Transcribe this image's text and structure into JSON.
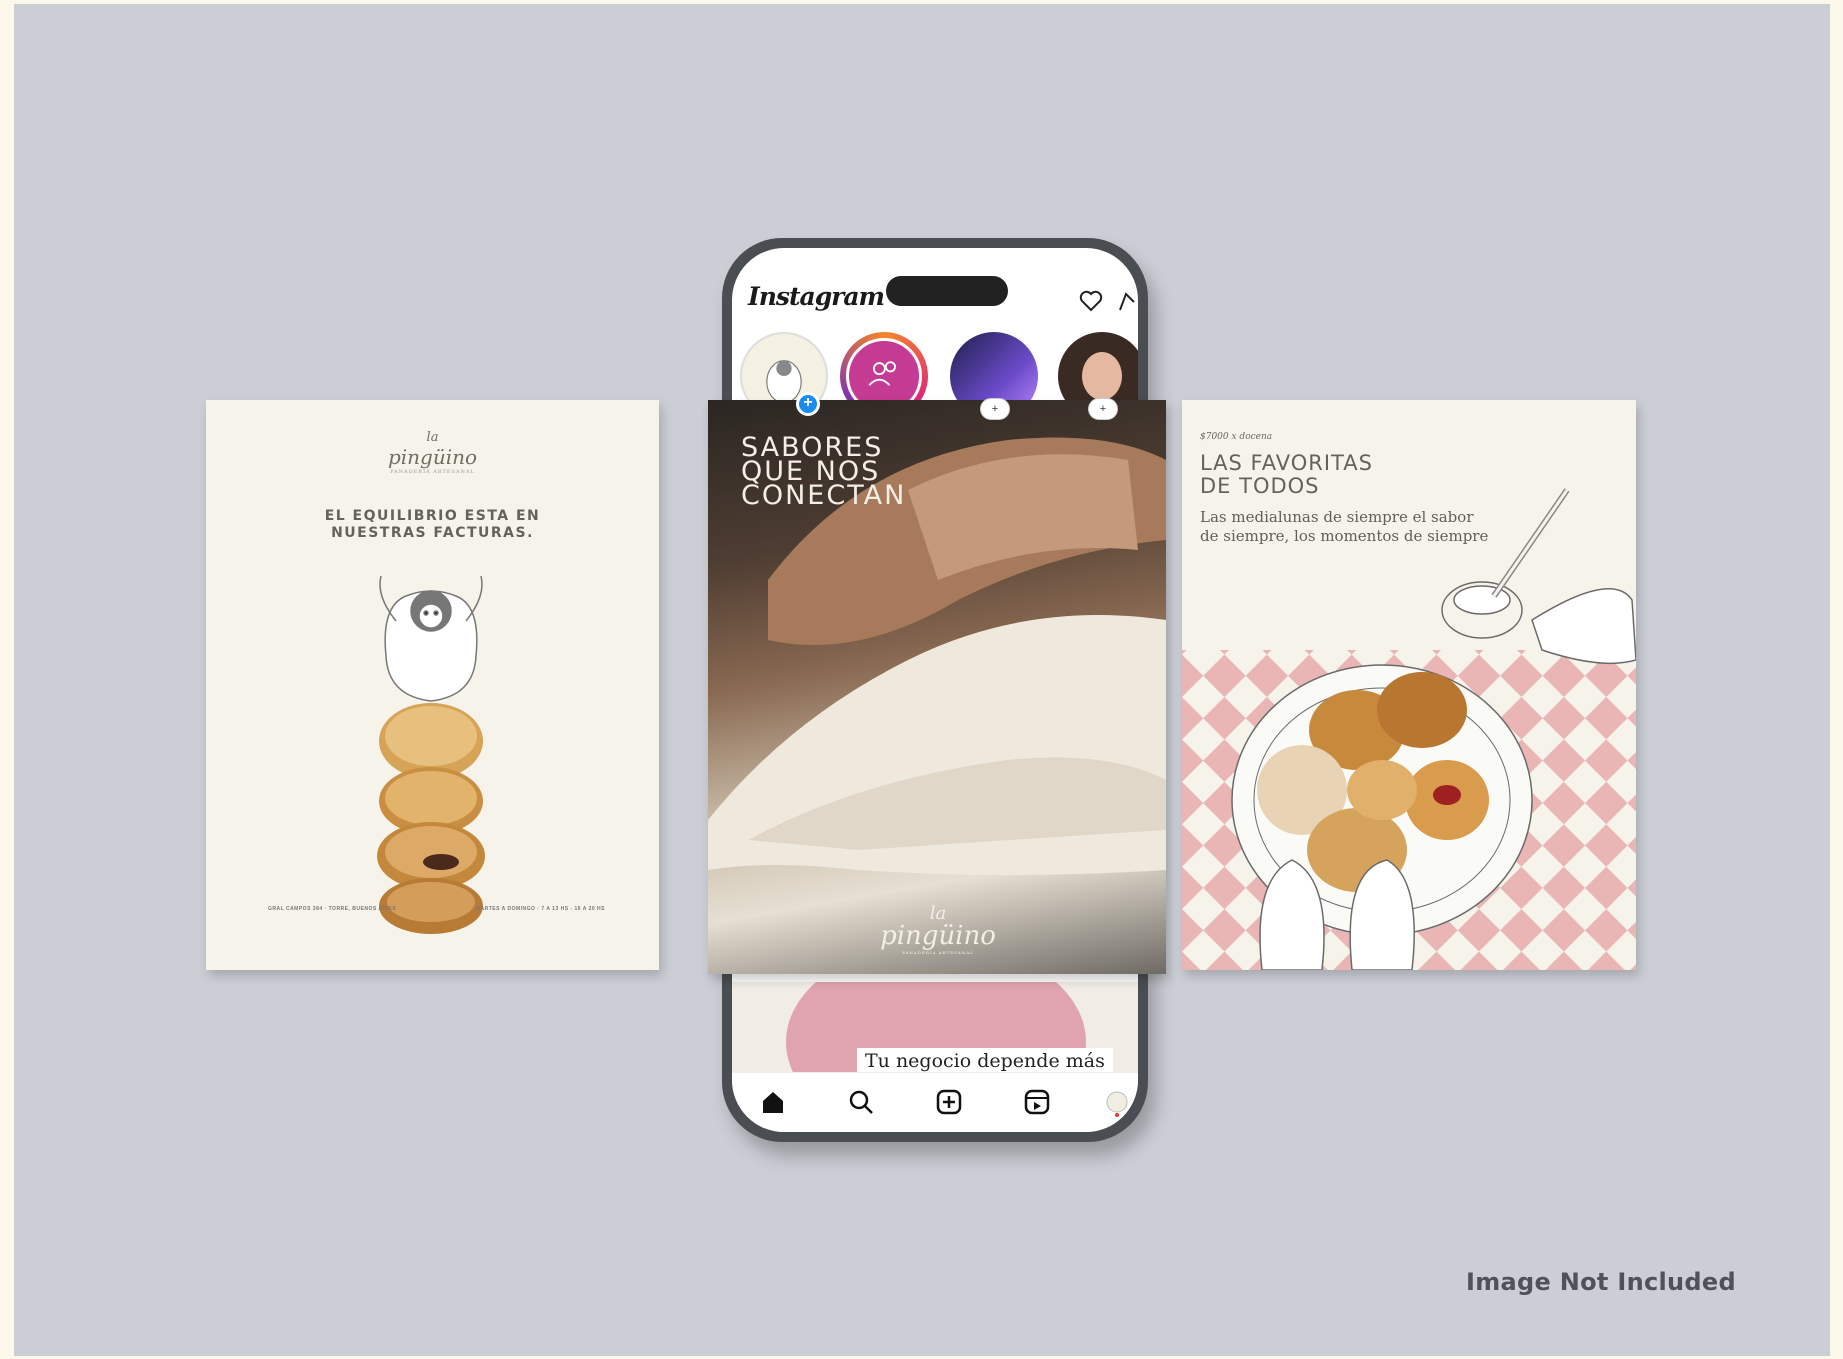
{
  "left_card": {
    "logo_line1": "la",
    "logo_line2": "pingüino",
    "logo_tagline": "PANADERIA ARTESANAL",
    "headline_line1": "EL EQUILIBRIO ESTA EN",
    "headline_line2": "NUESTRAS FACTURAS.",
    "address": "GRAL CAMPOS 384 · TORRE, BUENOS AIRES",
    "hours": "MARTES A DOMINGO · 7 A 13 HS - 16 A 20 HS"
  },
  "phone": {
    "brand": "Instagram",
    "stories": [
      {
        "name": "your-story",
        "badge": "+"
      },
      {
        "name": "close-friends",
        "badge": ""
      },
      {
        "name": "story-purple",
        "badge": "+"
      },
      {
        "name": "story-portrait",
        "badge": "+"
      }
    ],
    "post": {
      "title_line1": "SABORES",
      "title_line2": "QUE NOS",
      "title_line3": "CONECTAN",
      "logo_line1": "la",
      "logo_line2": "pingüino",
      "logo_tagline": "PANADERIA ARTESANAL"
    },
    "next_post_caption": "Tu negocio depende más",
    "tabs": [
      "home-icon",
      "search-icon",
      "create-icon",
      "reels-icon",
      "profile-icon"
    ]
  },
  "right_card": {
    "price": "$7000 x docena",
    "title_line1": "LAS FAVORITAS",
    "title_line2": "DE TODOS",
    "subtitle_line1": "Las medialunas de siempre el sabor",
    "subtitle_line2": "de siempre, los momentos de siempre"
  },
  "watermark": "Image Not Included",
  "colors": {
    "page_bg": "#fdf9ea",
    "stage_bg": "#ccced6",
    "card_bg": "#f6f3ea",
    "brand_text": "#62645a",
    "checker_pink": "#eab5b5",
    "phone_frame": "#4a4e52"
  }
}
